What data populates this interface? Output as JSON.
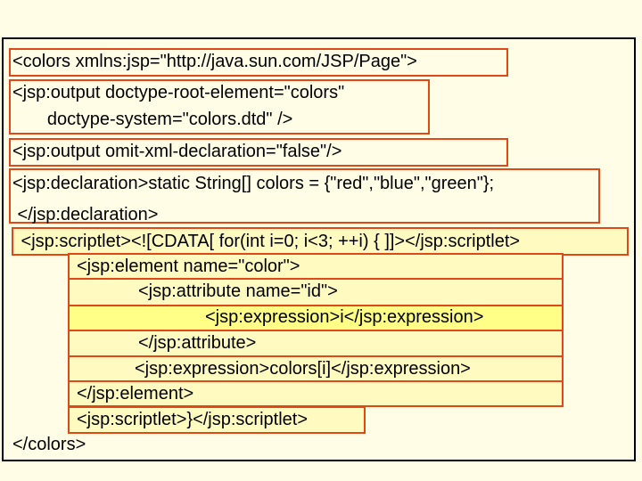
{
  "lines": [
    "<colors xmlns:jsp=\"http://java.sun.com/JSP/Page\">",
    "<jsp:output doctype-root-element=\"colors\"",
    "       doctype-system=\"colors.dtd\" />",
    "<jsp:output omit-xml-declaration=\"false\"/>",
    "<jsp:declaration>static String[] colors = {\"red\",\"blue\",\"green\"};",
    " </jsp:declaration>",
    " <jsp:scriptlet><![CDATA[ for(int i=0; i<3; ++i) { ]]></jsp:scriptlet>",
    "<jsp:element name=\"color\">",
    "<jsp:attribute name=\"id\">",
    "<jsp:expression>i</jsp:expression>",
    "</jsp:attribute>",
    "<jsp:expression>colors[i]</jsp:expression>",
    "</jsp:element>",
    "<jsp:scriptlet>}</jsp:scriptlet>",
    "</colors>"
  ],
  "colors": {
    "box_border": "#e0481a",
    "highlight": "#ffff88",
    "background": "#fffde6"
  }
}
